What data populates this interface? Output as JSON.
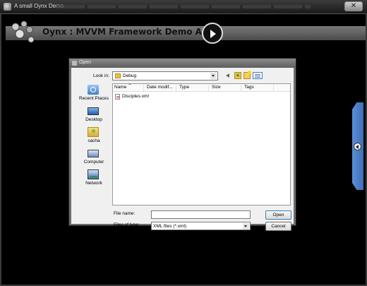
{
  "outer_window": {
    "title": "A small Oynx Demo",
    "close_glyph": "✕"
  },
  "app": {
    "title": "Oynx : MVVM Framework Demo App"
  },
  "dialog": {
    "title": "Open",
    "look_in_label": "Look in:",
    "look_in_value": "Debug",
    "places": [
      {
        "label": "Recent Places",
        "icon": "recent-places-icon"
      },
      {
        "label": "Desktop",
        "icon": "desktop-icon"
      },
      {
        "label": "sacha",
        "icon": "user-folder-icon"
      },
      {
        "label": "Computer",
        "icon": "computer-icon"
      },
      {
        "label": "Network",
        "icon": "network-icon"
      }
    ],
    "columns": [
      "Name",
      "Date modif...",
      "Type",
      "Size",
      "Tags"
    ],
    "files": [
      {
        "name": "Disciples.xml",
        "icon": "xml-file-icon"
      }
    ],
    "file_name_label": "File name:",
    "file_name_value": "",
    "file_type_label": "Files of type:",
    "file_type_value": "XML files (*.xml)",
    "open_label": "Open",
    "cancel_label": "Cancel"
  },
  "colors": {
    "background": "#000000",
    "side_tab": "#4a7fc8",
    "dialog_frame": "#6d6d6d"
  }
}
